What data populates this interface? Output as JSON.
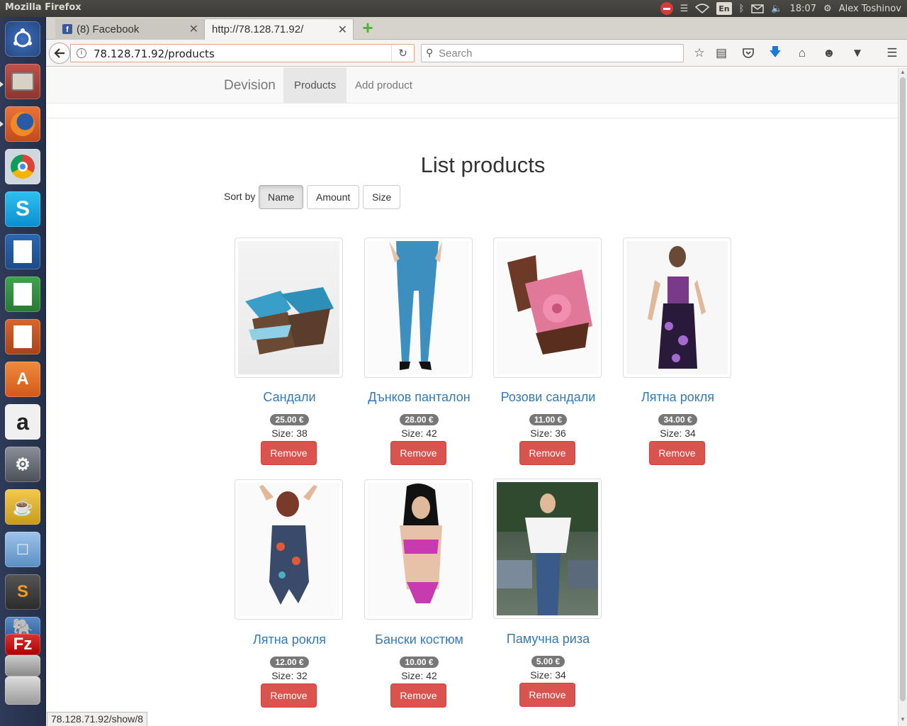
{
  "system": {
    "window_title": "Mozilla Firefox",
    "keyboard_layout": "En",
    "clock": "18:07",
    "user": "Alex Toshinov"
  },
  "browser": {
    "tabs": [
      {
        "label": "(8) Facebook",
        "favicon": "facebook-icon",
        "active": false
      },
      {
        "label": "http://78.128.71.92/",
        "active": true
      }
    ],
    "url": "78.128.71.92/products",
    "search_placeholder": "Search",
    "status_text": "78.128.71.92/show/8"
  },
  "site": {
    "brand": "Devision",
    "nav": [
      "Products",
      "Add product"
    ],
    "active_nav": "Products"
  },
  "main": {
    "title": "List products",
    "sort_label": "Sort by",
    "sort_options": [
      "Name",
      "Amount",
      "Size"
    ],
    "sort_active": "Name",
    "remove_label": "Remove",
    "products": [
      {
        "name": "Сандали",
        "price": "25.00 €",
        "size": "Size: 38",
        "image": "blue-sandals"
      },
      {
        "name": "Дънков панталон",
        "price": "28.00 €",
        "size": "Size: 42",
        "image": "denim-leggings"
      },
      {
        "name": "Розови сандали",
        "price": "11.00 €",
        "size": "Size: 36",
        "image": "pink-wedge-sandals"
      },
      {
        "name": "Лятна рокля",
        "price": "34.00 €",
        "size": "Size: 34",
        "image": "purple-floral-dress"
      },
      {
        "name": "Лятна рокля",
        "price": "12.00 €",
        "size": "Size: 32",
        "image": "floral-jumpsuit"
      },
      {
        "name": "Бански костюм",
        "price": "10.00 €",
        "size": "Size: 42",
        "image": "pink-swimsuit"
      },
      {
        "name": "Памучна риза",
        "price": "5.00 €",
        "size": "Size: 34",
        "image": "white-cotton-shirt"
      }
    ]
  },
  "colors": {
    "link": "#337ab7",
    "danger": "#d9534f",
    "badge": "#777777"
  }
}
